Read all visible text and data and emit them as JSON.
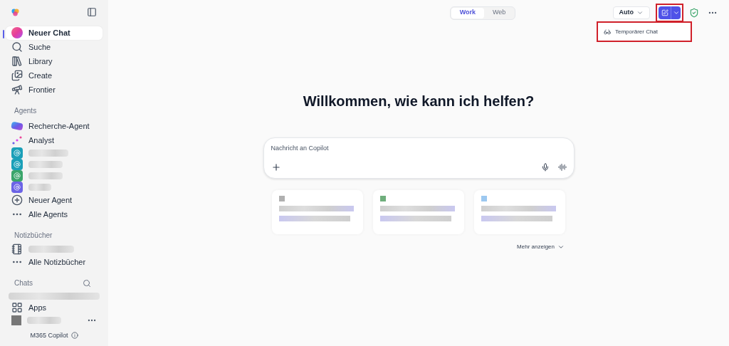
{
  "sidebar": {
    "nav": [
      {
        "label": "Neuer Chat",
        "selected": true
      },
      {
        "label": "Suche",
        "selected": false
      },
      {
        "label": "Library",
        "selected": false
      },
      {
        "label": "Create",
        "selected": false
      },
      {
        "label": "Frontier",
        "selected": false
      }
    ],
    "agents_heading": "Agents",
    "agents": [
      {
        "kind": "research",
        "label": "Recherche-Agent"
      },
      {
        "kind": "analyst",
        "label": "Analyst"
      },
      {
        "kind": "redacted",
        "color": "#1a9fb8"
      },
      {
        "kind": "redacted",
        "color": "#1a9fb8"
      },
      {
        "kind": "redacted",
        "color": "#3aa56a"
      },
      {
        "kind": "redacted",
        "color": "#6b63e6"
      },
      {
        "kind": "new",
        "label": "Neuer Agent"
      },
      {
        "kind": "all",
        "label": "Alle Agents"
      }
    ],
    "notebooks_heading": "Notizbücher",
    "notebooks": [
      {
        "kind": "redacted"
      },
      {
        "kind": "all",
        "label": "Alle Notizbücher"
      }
    ],
    "chats_heading": "Chats",
    "chats": [
      {
        "kind": "redacted"
      }
    ],
    "apps": "Apps",
    "footer": "M365 Copilot"
  },
  "header": {
    "tabs": [
      {
        "label": "Work",
        "selected": true
      },
      {
        "label": "Web",
        "selected": false
      }
    ],
    "model": "Auto",
    "new_chat_highlighted": true,
    "menu": {
      "items": [
        {
          "label": "Temporärer Chat"
        }
      ],
      "highlighted": true
    }
  },
  "main": {
    "heading": "Willkommen, wie kann ich helfen?",
    "composer": {
      "placeholder": "Nachricht an Copilot"
    },
    "cards": [
      {
        "color": "#b0b0b0"
      },
      {
        "color": "#6fae7c"
      },
      {
        "color": "#9cc8f0"
      }
    ],
    "more": "Mehr anzeigen"
  }
}
